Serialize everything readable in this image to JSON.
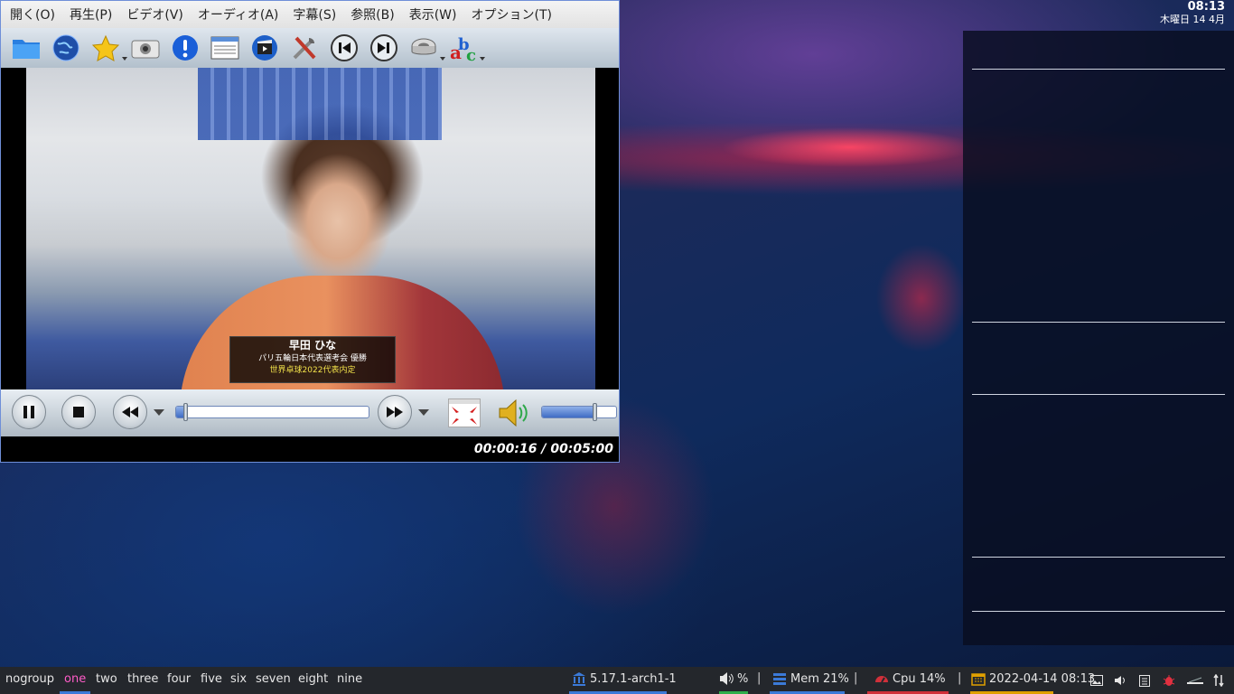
{
  "desktop": {
    "clock_time": "08:13",
    "clock_date": "木曜日 14 4月"
  },
  "player": {
    "menu": [
      "開く(O)",
      "再生(P)",
      "ビデオ(V)",
      "オーディオ(A)",
      "字幕(S)",
      "参照(B)",
      "表示(W)",
      "オプション(T)"
    ],
    "toolbar_icons": [
      "folder-icon",
      "globe-icon",
      "favorites-star-icon",
      "screenshot-camera-icon",
      "info-icon",
      "playlist-icon",
      "video-clapper-icon",
      "tools-icon",
      "previous-icon",
      "next-icon",
      "audio-track-icon",
      "subtitles-abc-icon"
    ],
    "caption": {
      "name": "早田 ひな",
      "line1": "パリ五輪日本代表選考会 優勝",
      "line2": "世界卓球2022代表内定"
    },
    "progress_percent": 5,
    "volume_percent": 70,
    "time_display": "00:00:16 / 00:05:00"
  },
  "taskbar": {
    "workspaces": [
      "nogroup",
      "one",
      "two",
      "three",
      "four",
      "five",
      "six",
      "seven",
      "eight",
      "nine"
    ],
    "active_workspace": "one",
    "kernel": "5.17.1-arch1-1",
    "volume": "%",
    "mem": "Mem 21%",
    "cpu": "Cpu  14%",
    "datetime": "2022-04-14 08:13",
    "sep": "|"
  },
  "colors": {
    "accent_active": "#ff5cc8",
    "kernel_ul": "#3b7ad8",
    "volume_ul": "#2fae4b",
    "mem_ul": "#3b7ad8",
    "cpu_ul": "#d0303a",
    "date_ul": "#e0a000"
  }
}
